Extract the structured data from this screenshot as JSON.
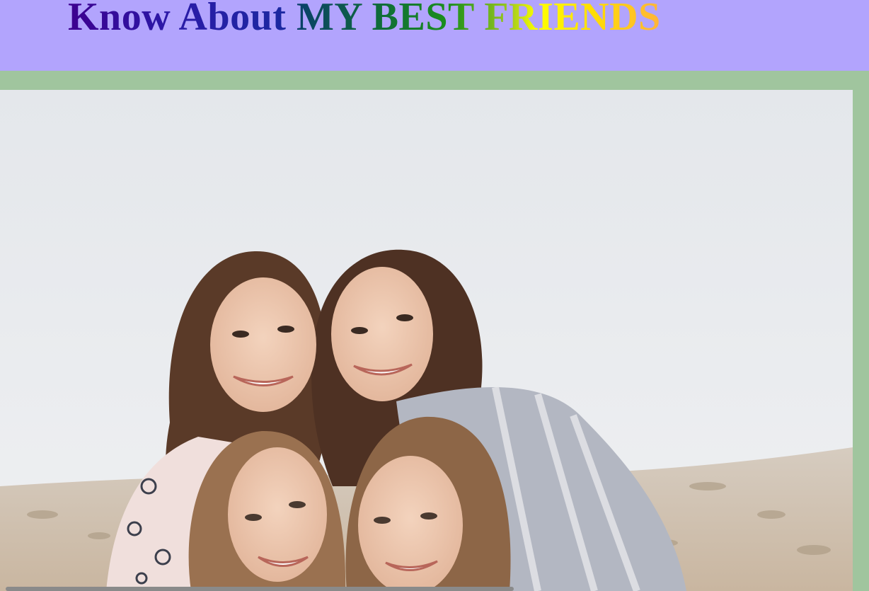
{
  "header": {
    "title_part_1": "Know About ",
    "title_part_2": "MY BEST FRIENDS",
    "background_color": "#b2a4fd"
  },
  "page": {
    "background_color": "#a0c59e"
  },
  "photo": {
    "subject": "photo-friends"
  }
}
